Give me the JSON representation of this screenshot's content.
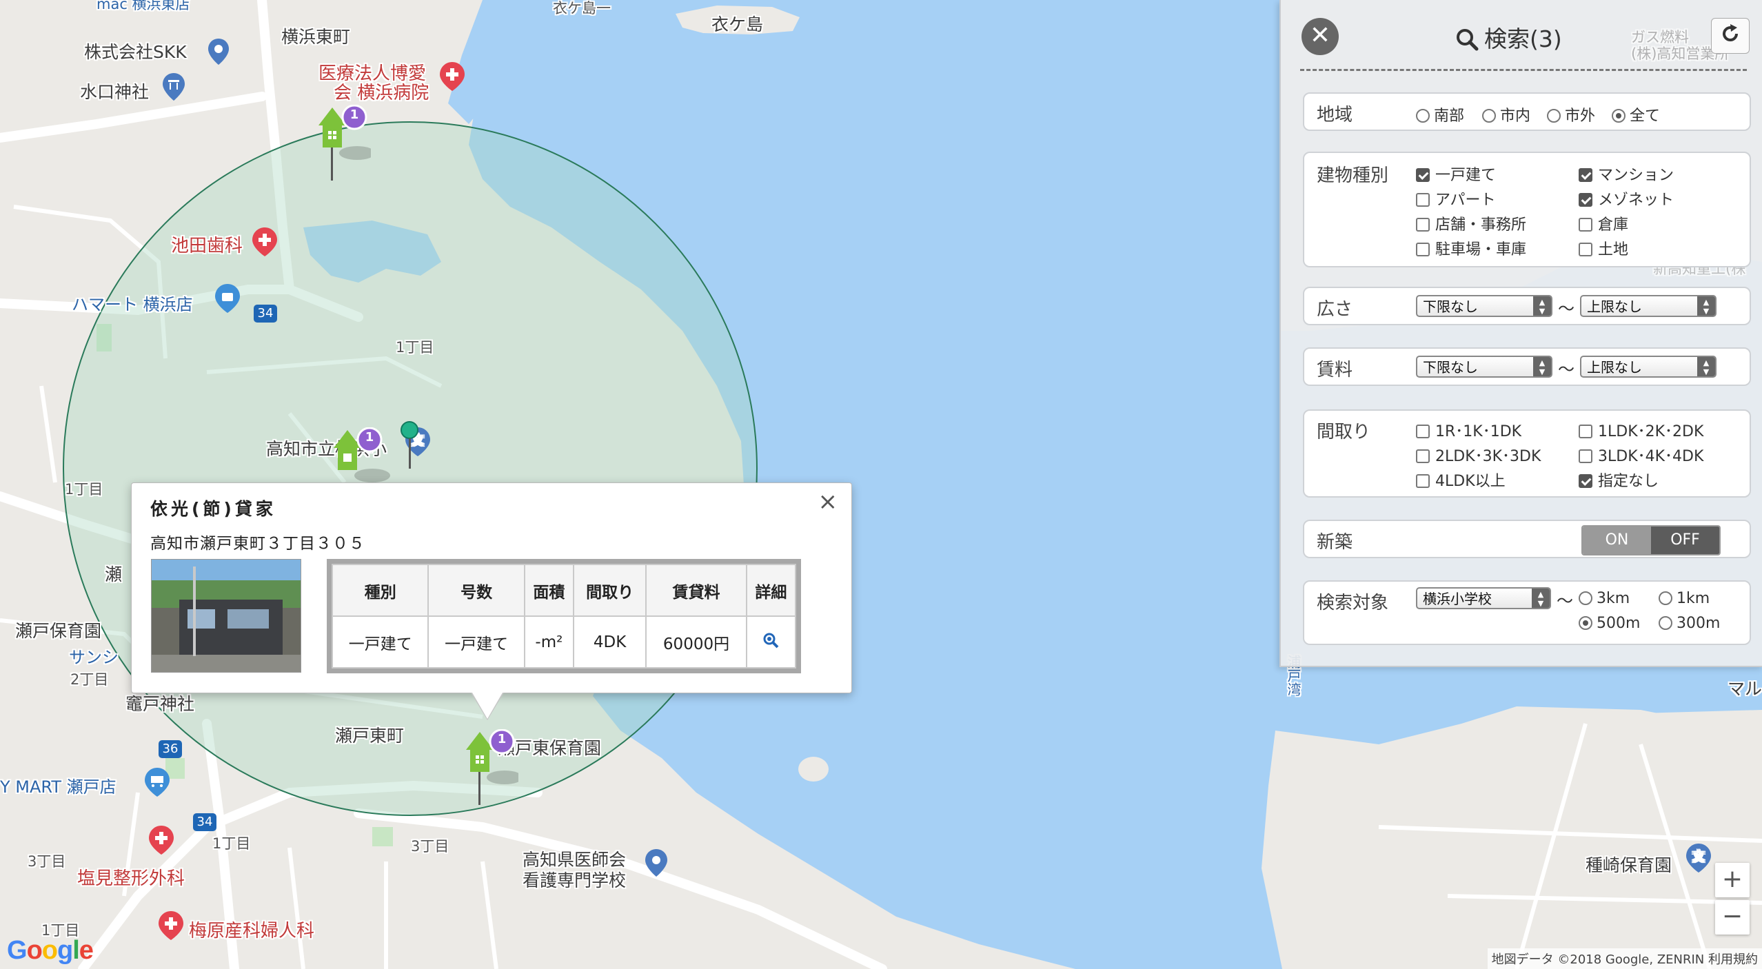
{
  "map": {
    "labels": {
      "kinugashima": "衣ケ島",
      "kinugashima_cut": "衣ケ島一",
      "yokohama_higashimachi": "横浜東町",
      "skk": "株式会社SKK",
      "mizuguchi": "水口神社",
      "hospital_l1": "医療法人博愛",
      "hospital_l2": "会 横浜病院",
      "ikeda": "池田歯科",
      "hamart": "ハマート 横浜店",
      "chome1_a": "1丁目",
      "chome1_b": "1丁目",
      "school": "高知市立横浜小",
      "seto_cut": "瀬",
      "seto_hoikuen": "瀬戸保育園",
      "sansu_cut": "サンシ",
      "chome2": "2丁目",
      "kamado": "竈戸神社",
      "setohigashimachi": "瀬戸東町",
      "setohigashi_hoikuen": "瀬戸東保育園",
      "ymart": "Y MART 瀬戸店",
      "chome1_c": "1丁目",
      "chome3_a": "3丁目",
      "chome3_b": "3丁目",
      "shiomi": "塩見整形外科",
      "ishikai_l1": "高知県医師会",
      "ishikai_l2": "看護専門学校",
      "umehara": "梅原産科婦人科",
      "chome1_d": "1丁目",
      "tanezaki": "種崎保育園",
      "mal_cut": "マル",
      "urado_bay": "浦戸湾",
      "gas_l1": "ガス燃料",
      "gas_l2": "(株)高知営業所",
      "shinkochi_cut": "新高知重工(株",
      "road_34a": "34",
      "road_34b": "34",
      "road_36": "36",
      "top_cut": "mac 横浜東店"
    },
    "markers": [
      {
        "name": "marker-house-north",
        "count": "1"
      },
      {
        "name": "marker-house-school",
        "count": "1"
      },
      {
        "name": "marker-house-south",
        "count": "1"
      }
    ],
    "zoom_in": "+",
    "zoom_out": "−",
    "attribution": "地図データ ©2018 Google, ZENRIN   利用規約",
    "logo": "Google"
  },
  "popup": {
    "title": "依光(節)貸家",
    "address": "高知市瀬戸東町３丁目３０５",
    "close": "×",
    "headers": [
      "種別",
      "号数",
      "面積",
      "間取り",
      "賃貸料",
      "詳細"
    ],
    "row": [
      "一戸建て",
      "一戸建て",
      "-m²",
      "4DK",
      "60000円"
    ]
  },
  "panel": {
    "title": "検索(3)",
    "region": {
      "label": "地域",
      "options": [
        {
          "label": "南部",
          "checked": false
        },
        {
          "label": "市内",
          "checked": false
        },
        {
          "label": "市外",
          "checked": false
        },
        {
          "label": "全て",
          "checked": true
        }
      ]
    },
    "building": {
      "label": "建物種別",
      "options": [
        {
          "label": "一戸建て",
          "checked": true
        },
        {
          "label": "マンション",
          "checked": true
        },
        {
          "label": "アパート",
          "checked": false
        },
        {
          "label": "メゾネット",
          "checked": true
        },
        {
          "label": "店舗・事務所",
          "checked": false
        },
        {
          "label": "倉庫",
          "checked": false
        },
        {
          "label": "駐車場・車庫",
          "checked": false
        },
        {
          "label": "土地",
          "checked": false
        }
      ]
    },
    "area": {
      "label": "広さ",
      "min": "下限なし",
      "max": "上限なし"
    },
    "rent": {
      "label": "賃料",
      "min": "下限なし",
      "max": "上限なし"
    },
    "layout": {
      "label": "間取り",
      "options": [
        {
          "label": "1R･1K･1DK",
          "checked": false
        },
        {
          "label": "1LDK･2K･2DK",
          "checked": false
        },
        {
          "label": "2LDK･3K･3DK",
          "checked": false
        },
        {
          "label": "3LDK･4K･4DK",
          "checked": false
        },
        {
          "label": "4LDK以上",
          "checked": false
        },
        {
          "label": "指定なし",
          "checked": true
        }
      ]
    },
    "newbuild": {
      "label": "新築",
      "on": "ON",
      "off": "OFF"
    },
    "target": {
      "label": "検索対象",
      "select": "横浜小学校",
      "distances": [
        {
          "label": "3km",
          "checked": false
        },
        {
          "label": "1km",
          "checked": false
        },
        {
          "label": "500m",
          "checked": true
        },
        {
          "label": "300m",
          "checked": false
        }
      ]
    },
    "tilde": "〜"
  },
  "colors": {
    "water": "#a6d0f5",
    "land": "#eceae6",
    "circle_fill": "#a8d8bf",
    "circle_stroke": "#2a7a5a",
    "marker_green": "#7dc23a",
    "badge_purple": "#8f5fcf"
  }
}
